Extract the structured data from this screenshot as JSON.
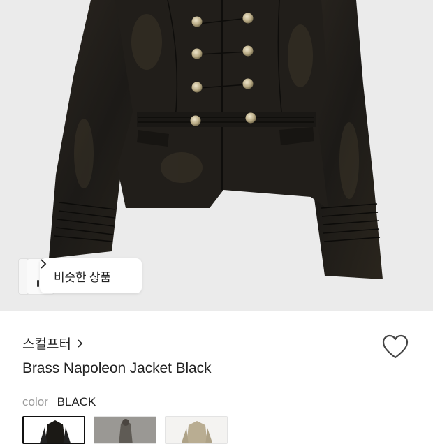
{
  "similar_button": {
    "label": "비슷한 상품"
  },
  "product": {
    "brand": "스컬프터",
    "title": "Brass Napoleon Jacket Black",
    "color_label": "color",
    "color_value": "BLACK",
    "swatches": [
      {
        "name": "black",
        "selected": true
      },
      {
        "name": "grey",
        "selected": false
      },
      {
        "name": "beige",
        "selected": false
      }
    ]
  },
  "icons": {
    "similar_chevron": "chevron-right-icon",
    "brand_chevron": "chevron-right-icon",
    "wishlist": "heart-outline-icon"
  }
}
